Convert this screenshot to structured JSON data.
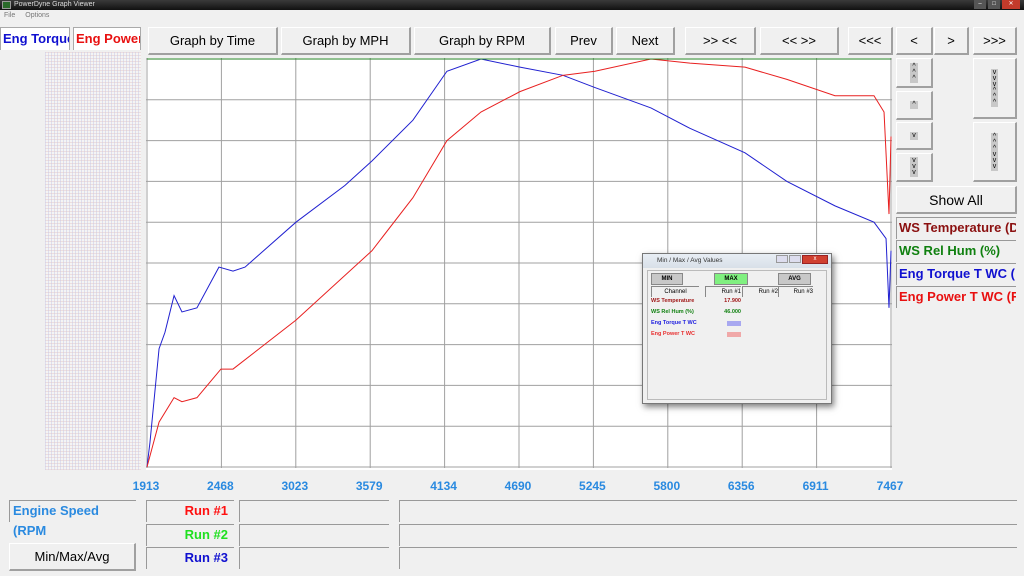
{
  "window": {
    "title": "PowerDyne Graph Viewer",
    "menu": [
      "File",
      "Options"
    ]
  },
  "tabs": [
    {
      "label": "Eng Torque",
      "color": "#1010d0"
    },
    {
      "label": "Eng Power",
      "color": "#e81010"
    }
  ],
  "toolbar": {
    "graph_by_time": "Graph by Time",
    "graph_by_mph": "Graph by MPH",
    "graph_by_rpm": "Graph by RPM",
    "prev": "Prev",
    "next": "Next",
    "zoom_in": ">> <<",
    "zoom_out": "<< >>",
    "scroll_start": "<<<",
    "step_left": "<",
    "step_right": ">",
    "scroll_end": ">>>"
  },
  "side": {
    "show_all": "Show All",
    "legend": [
      {
        "label": "WS Temperature (D",
        "color": "#8b1010"
      },
      {
        "label": "WS Rel Hum (%)",
        "color": "#108010"
      },
      {
        "label": "Eng Torque T WC (",
        "color": "#1010d0"
      },
      {
        "label": "Eng Power T WC (F",
        "color": "#e81010"
      }
    ]
  },
  "bottom": {
    "x_channel": "Engine Speed (RPM",
    "runs": [
      {
        "label": "Run #1",
        "color": "#ff1010"
      },
      {
        "label": "Run #2",
        "color": "#20e020"
      },
      {
        "label": "Run #3",
        "color": "#1010d0"
      }
    ],
    "min_max_avg": "Min/Max/Avg"
  },
  "dialog": {
    "title": "Min / Max / Avg Values",
    "min": "MIN",
    "max": "MAX",
    "avg": "AVG",
    "active": "MAX",
    "columns": [
      "Channel",
      "Run #1",
      "Run #2",
      "Run #3"
    ],
    "rows": [
      {
        "channel": "WS Temperature",
        "run1": "17.900",
        "color": "#a01818"
      },
      {
        "channel": "WS Rel Hum (%)",
        "run1": "46.000",
        "color": "#108010"
      },
      {
        "channel": "Eng Torque T WC",
        "run1": "",
        "color": "#2020e0"
      },
      {
        "channel": "Eng Power T WC",
        "run1": "",
        "color": "#e83030"
      }
    ]
  },
  "chart_data": {
    "type": "line",
    "xlabel": "Engine Speed (RPM",
    "xlim": [
      1913,
      7467
    ],
    "ylim": [
      0,
      100
    ],
    "xticks": [
      "1913",
      "2468",
      "3023",
      "3579",
      "4134",
      "4690",
      "5245",
      "5800",
      "6356",
      "6911",
      "7467"
    ],
    "grid": true,
    "y_gridlines": 10,
    "series": [
      {
        "name": "Eng Torque T WC",
        "color": "#2020d0",
        "points": [
          [
            1913,
            0
          ],
          [
            1935,
            6
          ],
          [
            2003,
            29
          ],
          [
            2047,
            33
          ],
          [
            2115,
            42
          ],
          [
            2174,
            38
          ],
          [
            2286,
            39
          ],
          [
            2450,
            49
          ],
          [
            2555,
            48
          ],
          [
            2645,
            49
          ],
          [
            3025,
            60
          ],
          [
            3390,
            69
          ],
          [
            3592,
            75
          ],
          [
            3898,
            85
          ],
          [
            4152,
            97
          ],
          [
            4406,
            100
          ],
          [
            4697,
            98
          ],
          [
            5018,
            96
          ],
          [
            5257,
            93
          ],
          [
            5675,
            88
          ],
          [
            5966,
            83
          ],
          [
            6377,
            77
          ],
          [
            6690,
            70
          ],
          [
            7049,
            64
          ],
          [
            7340,
            60
          ],
          [
            7430,
            56
          ],
          [
            7452,
            39
          ],
          [
            7467,
            53
          ]
        ]
      },
      {
        "name": "Eng Power T WC",
        "color": "#e82020",
        "points": [
          [
            1913,
            0
          ],
          [
            2003,
            11
          ],
          [
            2115,
            17
          ],
          [
            2174,
            16
          ],
          [
            2286,
            17
          ],
          [
            2465,
            24
          ],
          [
            2555,
            24
          ],
          [
            3025,
            36
          ],
          [
            3592,
            53
          ],
          [
            3898,
            66
          ],
          [
            4152,
            80
          ],
          [
            4406,
            87
          ],
          [
            4697,
            92
          ],
          [
            5018,
            96
          ],
          [
            5257,
            97
          ],
          [
            5675,
            100
          ],
          [
            5966,
            99
          ],
          [
            6377,
            98
          ],
          [
            6690,
            95
          ],
          [
            7049,
            91
          ],
          [
            7340,
            91
          ],
          [
            7415,
            87
          ],
          [
            7452,
            62
          ],
          [
            7467,
            81
          ]
        ]
      },
      {
        "name": "WS Rel Hum (%)",
        "color": "#208020",
        "points": [
          [
            1913,
            100
          ],
          [
            7467,
            100
          ]
        ]
      }
    ]
  }
}
